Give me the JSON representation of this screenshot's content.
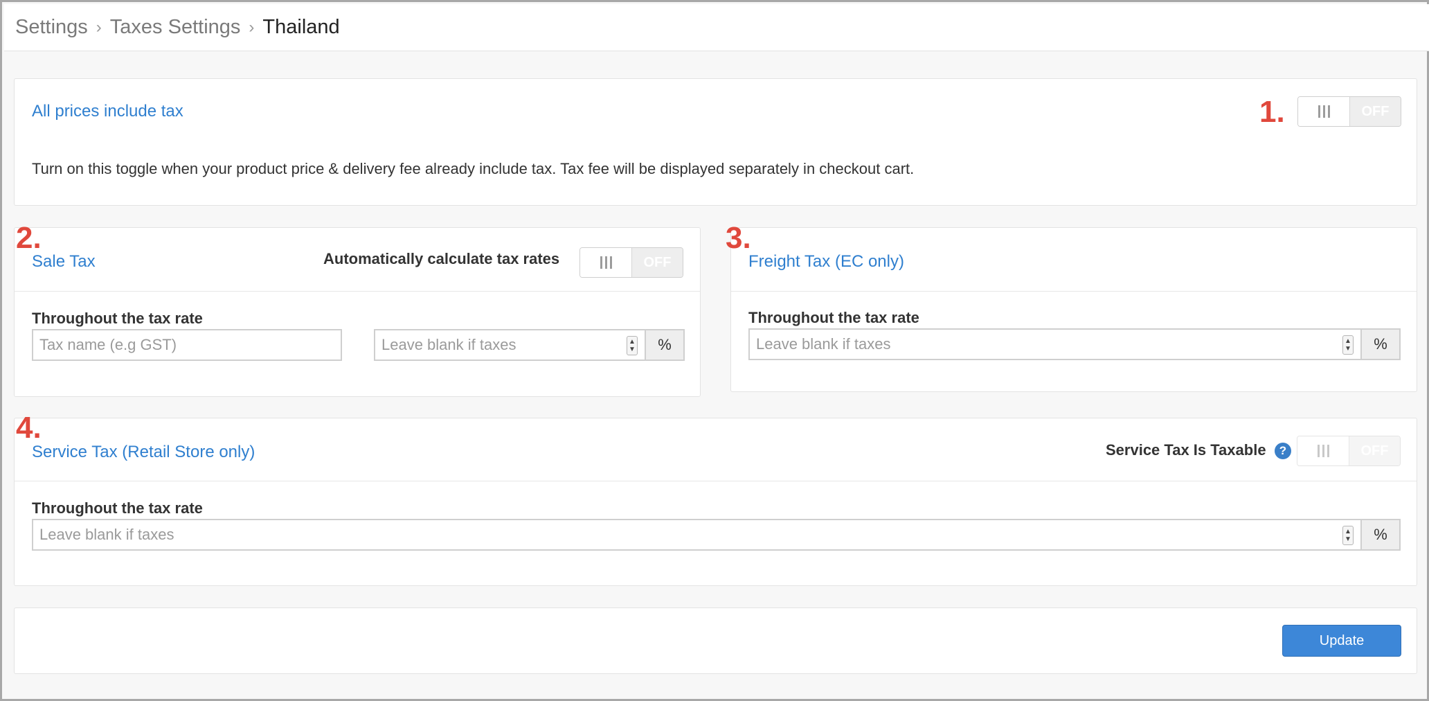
{
  "breadcrumb": [
    "Settings",
    "Taxes Settings",
    "Thailand"
  ],
  "markers": [
    "1.",
    "2.",
    "3.",
    "4."
  ],
  "all_prices": {
    "title": "All prices include tax",
    "description": "Turn on this toggle when your product price & delivery fee already include tax. Tax fee will be displayed separately in checkout cart.",
    "toggle_state": "OFF"
  },
  "sale_tax": {
    "title": "Sale Tax",
    "auto_label": "Automatically calculate tax rates",
    "toggle_state": "OFF",
    "field_label": "Throughout the tax rate",
    "name_placeholder": "Tax name (e.g GST)",
    "rate_placeholder": "Leave blank if taxes",
    "unit": "%"
  },
  "freight_tax": {
    "title": "Freight Tax (EC only)",
    "field_label": "Throughout the tax rate",
    "rate_placeholder": "Leave blank if taxes",
    "unit": "%"
  },
  "service_tax": {
    "title": "Service Tax (Retail Store only)",
    "taxable_label": "Service Tax Is Taxable",
    "help_symbol": "?",
    "toggle_state": "OFF",
    "field_label": "Throughout the tax rate",
    "rate_placeholder": "Leave blank if taxes",
    "unit": "%"
  },
  "actions": {
    "update_label": "Update"
  },
  "colors": {
    "accent": "#2f7fcf",
    "marker": "#e0483c",
    "button": "#3d87d8"
  },
  "icons": {
    "spinner_up": "▲",
    "spinner_down": "▼"
  }
}
